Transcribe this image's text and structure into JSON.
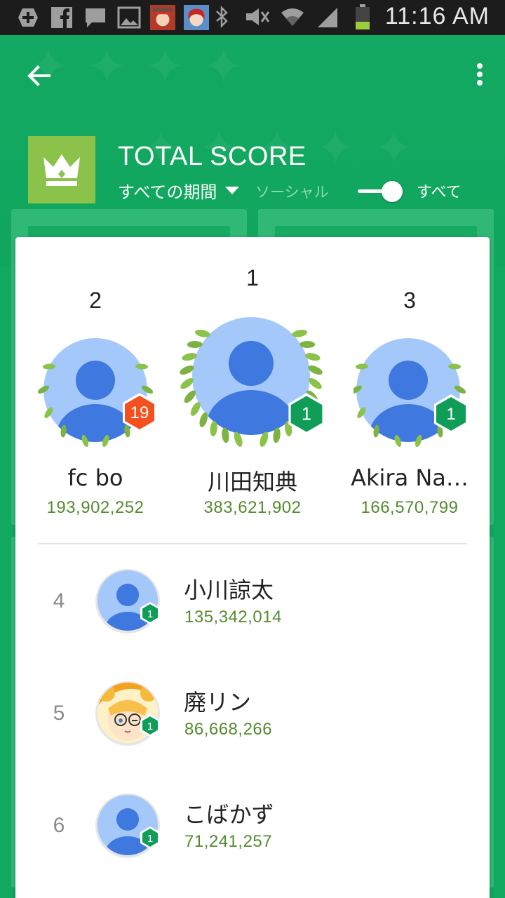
{
  "statusbar": {
    "time": "11:16 AM",
    "icons": [
      "add-box-icon",
      "facebook-icon",
      "chat-icon",
      "image-icon",
      "app-avatar-1",
      "app-avatar-2",
      "bluetooth-icon",
      "mute-icon",
      "wifi-icon",
      "signal-icon",
      "battery-icon"
    ],
    "battery_level": 0.35
  },
  "header": {
    "back_icon": "arrow-back-icon",
    "menu_icon": "more-vert-icon",
    "leaderboard_icon": "crown-icon",
    "title": "TOTAL SCORE",
    "period_label": "すべての期間",
    "social_label": "ソーシャル",
    "all_label": "すべて",
    "toggle_on": true
  },
  "podium": [
    {
      "rank": "2",
      "name": "fc bo",
      "score": "193,902,252",
      "level": "19",
      "level_color": "#f4511e"
    },
    {
      "rank": "1",
      "name": "川田知典",
      "score": "383,621,902",
      "level": "1",
      "level_color": "#0f9d58"
    },
    {
      "rank": "3",
      "name": "Akira Na…",
      "score": "166,570,799",
      "level": "1",
      "level_color": "#0f9d58"
    }
  ],
  "list": [
    {
      "rank": "4",
      "name": "小川諒太",
      "score": "135,342,014",
      "level": "1",
      "avatar": "default-avatar"
    },
    {
      "rank": "5",
      "name": "廃リン",
      "score": "86,668,266",
      "level": "1",
      "avatar": "anime-avatar"
    },
    {
      "rank": "6",
      "name": "こばかず",
      "score": "71,241,257",
      "level": "1",
      "avatar": "default-avatar"
    }
  ],
  "colors": {
    "accent_green": "#11a85f",
    "crown_tile": "#8bc34a",
    "score_text": "#558b2f",
    "level_badge": "#0f9d58",
    "level_badge_high": "#f4511e",
    "avatar_light": "#a5c8fb",
    "avatar_dark": "#3f78de"
  }
}
